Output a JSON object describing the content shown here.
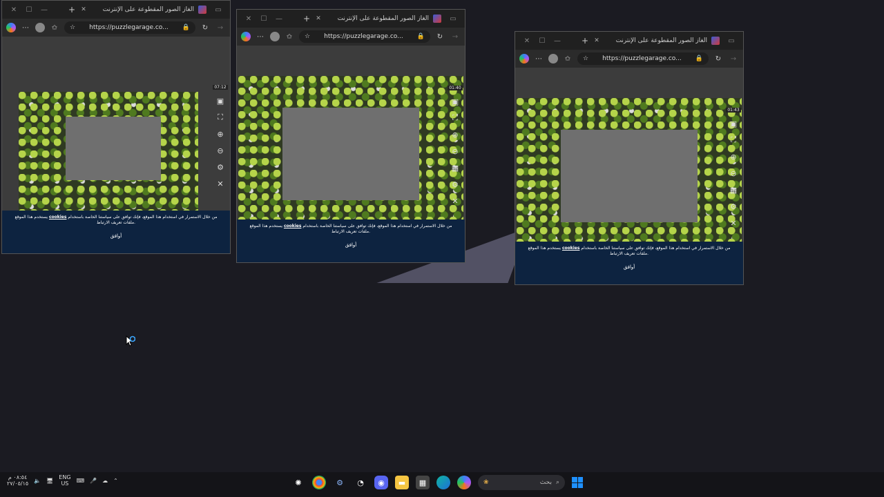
{
  "browser": {
    "tab_title": "ألغاز الصور المقطوعة على الإنترنت",
    "url": "https://puzzlegarage.co...",
    "controls": {
      "close": "✕",
      "maximize": "☐",
      "minimize": "—",
      "new_tab": "+",
      "tab_close": "✕"
    }
  },
  "windows": [
    {
      "timer": "07:12",
      "cookie_text_pre": "يستخدم هذا الموقع",
      "cookie_link": "cookies",
      "cookie_text_post": "من خلال الاستمرار في استخدام هذا الموقع، فإنك توافق على سياستنا الخاصة باستخدام ملفات تعريف الارتباط.",
      "ok": "أوافق"
    },
    {
      "timer": "01:40",
      "cookie_text_pre": "يستخدم هذا الموقع",
      "cookie_link": "cookies",
      "cookie_text_post": "من خلال الاستمرار في استخدام هذا الموقع، فإنك توافق على سياستنا الخاصة باستخدام ملفات تعريف الارتباط.",
      "ok": "أوافق"
    },
    {
      "timer": "01:43",
      "cookie_text_pre": "يستخدم هذا الموقع",
      "cookie_link": "cookies",
      "cookie_text_post": "من خلال الاستمرار في استخدام هذا الموقع، فإنك توافق على سياستنا الخاصة باستخدام ملفات تعريف الارتباط.",
      "ok": "أوافق"
    }
  ],
  "taskbar": {
    "clock_time": "٠٨:٥٤ م",
    "clock_date": "٢٧/٠٥/١٥",
    "lang_top": "ENG",
    "lang_bottom": "US",
    "search_placeholder": "بحث"
  }
}
